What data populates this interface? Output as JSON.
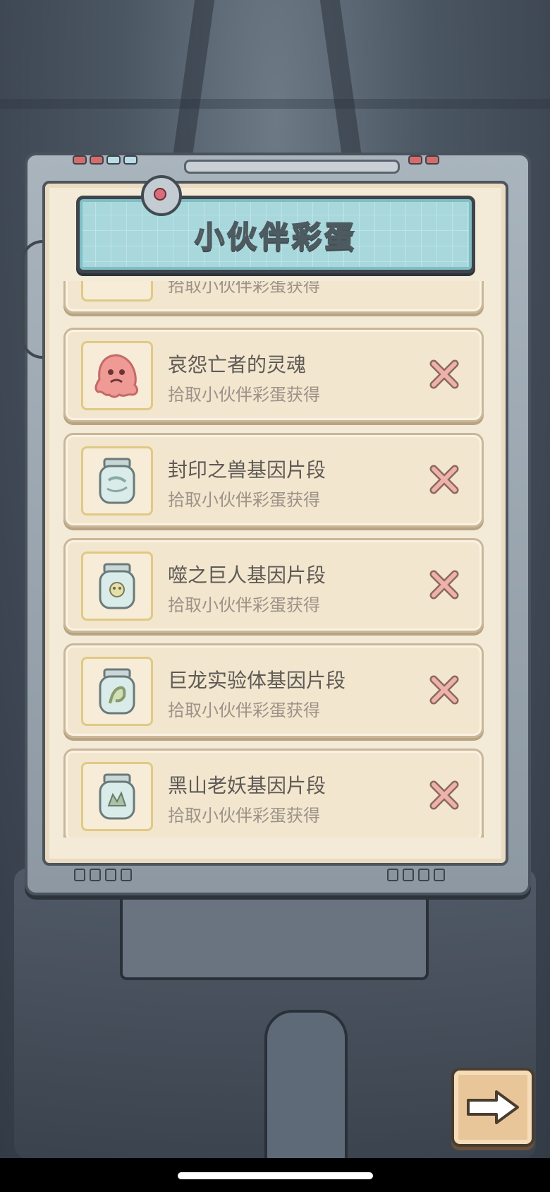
{
  "dialog": {
    "title": "小伙伴彩蛋"
  },
  "partial_item": {
    "subtitle": "拾取小伙伴彩蛋获得"
  },
  "items": [
    {
      "name": "哀怨亡者的灵魂",
      "subtitle": "拾取小伙伴彩蛋获得",
      "icon": "pink-ghost-icon"
    },
    {
      "name": "封印之兽基因片段",
      "subtitle": "拾取小伙伴彩蛋获得",
      "icon": "gene-jar-icon"
    },
    {
      "name": "噬之巨人基因片段",
      "subtitle": "拾取小伙伴彩蛋获得",
      "icon": "gene-jar-icon"
    },
    {
      "name": "巨龙实验体基因片段",
      "subtitle": "拾取小伙伴彩蛋获得",
      "icon": "gene-jar-icon"
    },
    {
      "name": "黑山老妖基因片段",
      "subtitle": "拾取小伙伴彩蛋获得",
      "icon": "gene-jar-icon"
    }
  ],
  "colors": {
    "card_bg": "#f3e6cf",
    "x_mark": "#e8a39a",
    "title_plate": "#a8d8dc"
  },
  "next_button": {
    "icon": "right-arrow-icon"
  }
}
